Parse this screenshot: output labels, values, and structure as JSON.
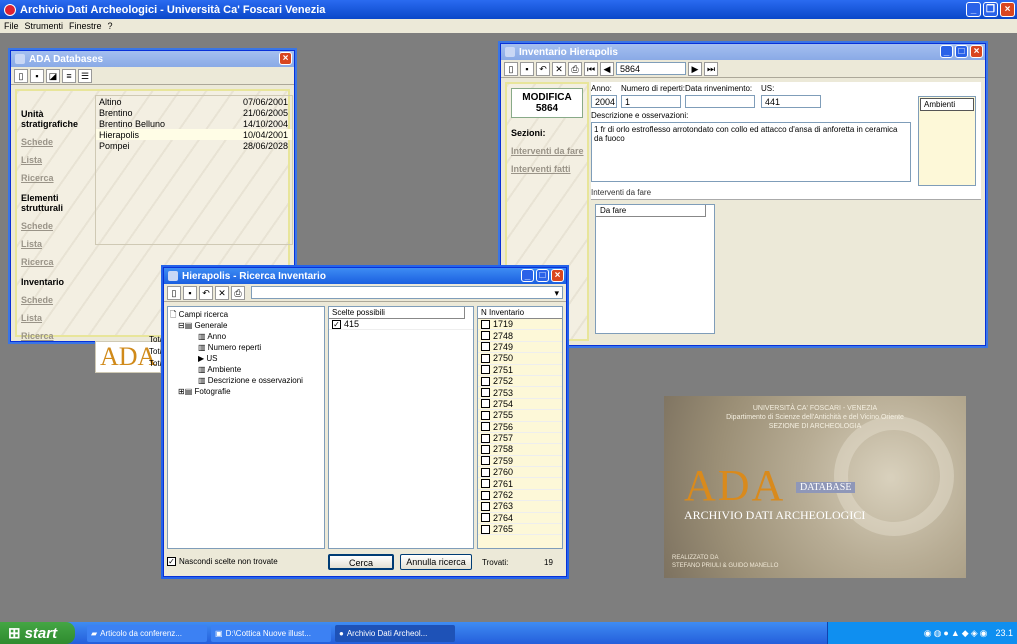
{
  "app": {
    "title": "Archivio Dati Archeologici - Università Ca' Foscari Venezia"
  },
  "menu": [
    "File",
    "Strumenti",
    "Finestre",
    "?"
  ],
  "ada_window": {
    "title": "ADA Databases",
    "sections": [
      {
        "label": "Unità stratigrafiche",
        "links": [
          "Schede",
          "Lista",
          "Ricerca"
        ]
      },
      {
        "label": "Elementi strutturali",
        "links": [
          "Schede",
          "Lista",
          "Ricerca"
        ]
      },
      {
        "label": "Inventario",
        "links": [
          "Schede",
          "Lista",
          "Ricerca"
        ]
      }
    ],
    "databases": [
      {
        "name": "Altino",
        "date": "07/06/2001"
      },
      {
        "name": "Brentino",
        "date": "21/06/2005"
      },
      {
        "name": "Brentino Belluno",
        "date": "14/10/2004"
      },
      {
        "name": "Hierapolis",
        "date": "10/04/2001"
      },
      {
        "name": "Pompei",
        "date": "28/06/2028"
      }
    ],
    "logo": "ADA",
    "totals": [
      "Total",
      "Total",
      "Total"
    ]
  },
  "inventario_window": {
    "title": "Inventario Hierapolis",
    "record_nav": "5864",
    "modifica_label": "MODIFICA",
    "modifica_number": "5864",
    "sezioni_label": "Sezioni:",
    "links": [
      "Interventi da fare",
      "Interventi fatti"
    ],
    "fields": {
      "anno_label": "Anno:",
      "anno": "2004",
      "reperti_label": "Numero di reperti:",
      "reperti": "1",
      "data_label": "Data rinvenimento:",
      "data": "",
      "us_label": "US:",
      "us": "441"
    },
    "desc_label": "Descrizione e osservazioni:",
    "desc": "1 fr di orlo estroflesso arrotondato con collo ed attacco d'ansa di anforetta in ceramica da fuoco",
    "ambienti_label": "Ambienti",
    "interventi_label": "Interventi da fare",
    "da_fare_header": "Da fare"
  },
  "ricerca_window": {
    "title": "Hierapolis - Ricerca Inventario",
    "tree": {
      "root": "Campi ricerca",
      "group": "Generale",
      "fields": [
        "Anno",
        "Numero reperti",
        "US",
        "Ambiente",
        "Descrizione e osservazioni"
      ],
      "group2": "Fotografie"
    },
    "scelte_header": "Scelte possibili",
    "scelte": [
      "415"
    ],
    "ninv_header": "N Inventario",
    "inventario": [
      "1719",
      "2748",
      "2749",
      "2750",
      "2751",
      "2752",
      "2753",
      "2754",
      "2755",
      "2756",
      "2757",
      "2758",
      "2759",
      "2760",
      "2761",
      "2762",
      "2763",
      "2764",
      "2765"
    ],
    "nascondi_label": "Nascondi scelte non trovate",
    "cerca_label": "Cerca",
    "annulla_label": "Annulla ricerca",
    "trovati_label": "Trovati:",
    "trovati_value": "19"
  },
  "splash": {
    "line1": "UNIVERSITÀ CA' FOSCARI - VENEZIA",
    "line2": "Dipartimento di Scienze dell'Antichità e del Vicino Oriente",
    "line3": "SEZIONE DI ARCHEOLOGIA",
    "logo": "ADA",
    "database": "DATABASE",
    "name": "ARCHIVIO DATI ARCHEOLOGICI",
    "credit1": "REALIZZATO DA",
    "credit2": "STEFANO PRIULI & GUIDO MANELLO"
  },
  "taskbar": {
    "start": "start",
    "tasks": [
      "Articolo da conferenz...",
      "D:\\Cottica Nuove illust...",
      "Archivio Dati Archeol..."
    ],
    "clock": "23.1"
  },
  "colors": {
    "title_blue": "#0a47c9",
    "taskbar_blue": "#245edb",
    "start_green": "#2f8b2f",
    "desktop_grey": "#7e7e7e"
  }
}
